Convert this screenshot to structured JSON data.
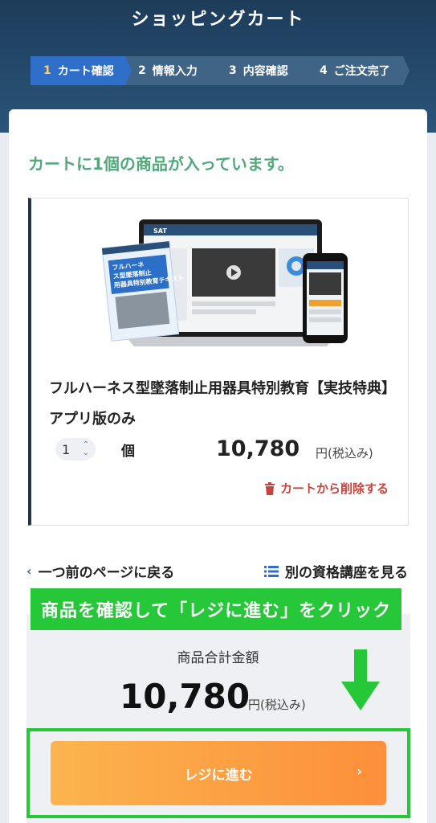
{
  "header": {
    "title": "ショッピングカート"
  },
  "steps": [
    {
      "num": "1",
      "label": "カート確認",
      "active": true
    },
    {
      "num": "2",
      "label": "情報入力"
    },
    {
      "num": "3",
      "label": "内容確認"
    },
    {
      "num": "4",
      "label": "ご注文完了"
    }
  ],
  "cart": {
    "message": "カートに1個の商品が入っています。"
  },
  "product": {
    "name": "フルハーネス型墜落制止用器具特別教育【実技特典】アプリ版のみ",
    "quantity": "1",
    "unit": "個",
    "price": "10,780",
    "price_unit": "円(税込み)",
    "remove_label": "カートから削除する",
    "image": {
      "logo": "SAT",
      "book_title": "フルハーネス型墜落制止用器具特別教育テキスト"
    }
  },
  "nav": {
    "back_label": "一つ前のページに戻る",
    "other_label": "別の資格講座を見る"
  },
  "annotation": {
    "text": "商品を確認して「レジに進む」をクリック"
  },
  "summary": {
    "label": "商品合計金額",
    "price": "10,780",
    "price_unit": "円(税込み)"
  },
  "checkout": {
    "label": "レジに進む"
  },
  "colors": {
    "header": "#1e3c5a",
    "step_active": "#2f6fc9",
    "step_inactive": "#3f6486",
    "cart_msg": "#4fa97b",
    "remove": "#c9423b",
    "annotation": "#27c73a",
    "checkout_start": "#fcb44e",
    "checkout_end": "#fc8f3b"
  },
  "icons": [
    "trash-icon",
    "chevron-left-icon",
    "list-icon",
    "chevron-right-icon",
    "arrow-down-icon",
    "stepper-icon"
  ]
}
